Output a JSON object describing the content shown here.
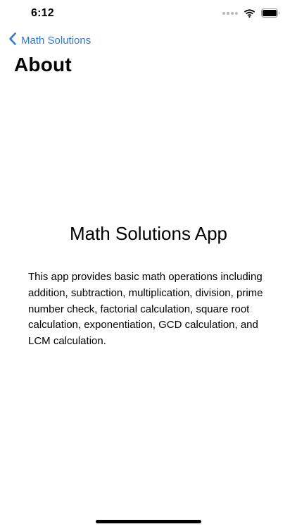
{
  "status_bar": {
    "time": "6:12"
  },
  "nav": {
    "back_label": "Math Solutions",
    "title": "About"
  },
  "main": {
    "app_name": "Math Solutions App",
    "description": "This app provides basic math operations including addition, subtraction, multiplication, division, prime number check, factorial calculation, square root calculation, exponentiation, GCD calculation, and LCM calculation."
  },
  "icons": {
    "back": "chevron-left-icon",
    "wifi": "wifi-icon",
    "battery": "battery-icon",
    "signal": "signal-icon"
  },
  "colors": {
    "accent": "#2f7bd1",
    "text": "#000000",
    "background": "#ffffff"
  }
}
